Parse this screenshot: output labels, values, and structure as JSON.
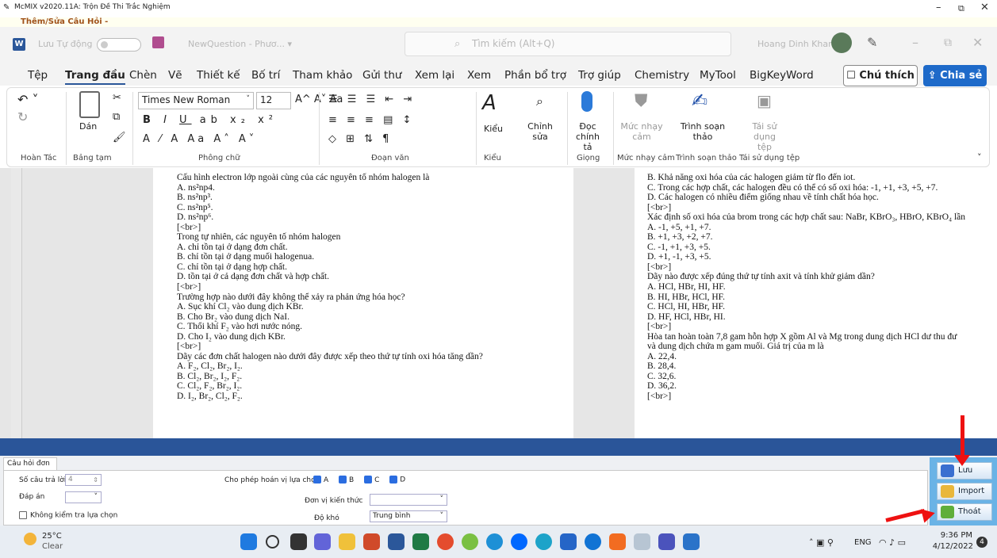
{
  "window": {
    "title": "McMIX v2020.11A: Trộn Đề Thi Trắc Nghiệm",
    "subtitle": "Thêm/Sửa Câu Hỏi -"
  },
  "word": {
    "autosave": "Lưu Tự động",
    "doc_name": "NewQuestion - Phươ... ▾",
    "search_placeholder": "Tìm kiếm (Alt+Q)",
    "user": "Hoang Dinh Khanh",
    "menu": [
      "Tệp",
      "Trang đầu",
      "Chèn",
      "Vẽ",
      "Thiết kế",
      "Bố trí",
      "Tham khảo",
      "Gửi thư",
      "Xem lại",
      "Xem",
      "Phần bổ trợ",
      "Trợ giúp",
      "Chemistry",
      "MyTool",
      "BigKeyWord"
    ],
    "note_button": "Chú thích",
    "share_button": "Chia sẻ"
  },
  "ribbon": {
    "font_name": "Times New Roman",
    "font_size": "12",
    "paste": "Dán",
    "styles": "Kiểu",
    "edit": "Chỉnh sửa",
    "dictate": "Đọc chính tả",
    "sensitivity": "Mức nhạy cảm",
    "editor": "Trình soạn thảo",
    "reuse": "Tái sử dụng tệp",
    "groups": [
      "Hoàn Tác",
      "Bảng tạm",
      "Phông chữ",
      "Đoạn văn",
      "Kiểu",
      "Giọng",
      "Mức nhạy cảm",
      "Trình soạn thảo",
      "Tái sử dụng tệp"
    ]
  },
  "doc": {
    "left": [
      "Cấu hình electron lớp ngoài cùng của các nguyên tố nhóm halogen là",
      "A. ns²np4.",
      "B. ns²np³.",
      "C. ns²np⁵.",
      "D. ns²np⁶.",
      "[<br>]",
      "Trong tự nhiên, các nguyên tố nhóm halogen",
      "A. chỉ tồn tại ở dạng đơn chất.",
      "B. chỉ tồn tại ở dạng muối halogenua.",
      "C. chỉ tồn tại ở dạng hợp chất.",
      "D. tồn tại ở cả dạng đơn chất và hợp chất.",
      "[<br>]",
      "Trường hợp nào dưới đây không thể xảy ra phản ứng hóa học?",
      "A. Sục khí Cl₂ vào dung dịch KBr.",
      "B. Cho Br₂ vào dung dịch NaI.",
      "C. Thổi khí F₂ vào hơi nước nóng.",
      "D. Cho I₂ vào dung dịch KBr.",
      "[<br>]",
      "Dãy các đơn chất halogen nào dưới đây được xếp theo thứ tự tính oxi hóa tăng dần?",
      "A. F₂, Cl₂, Br₂, I₂.",
      "B. Cl₂, Br₂, I₂, F₂.",
      "C. Cl₂, F₂, Br₂, I₂.",
      "D. I₂, Br₂, Cl₂, F₂."
    ],
    "right": [
      "B. Khả năng oxi hóa của các halogen giảm từ flo đến iot.",
      "C. Trong các hợp chất, các halogen đều có thể có số oxi hóa: -1, +1, +3, +5, +7.",
      "D. Các halogen có nhiều điểm giống nhau về tính chất hóa học.",
      "[<br>]",
      "Xác định số oxi hóa của brom trong các hợp chất sau: NaBr, KBrO₃, HBrO, KBrO₄ lần",
      "A. -1, +5, +1, +7.",
      "B. +1, +3, +2, +7.",
      "C. -1, +1, +3, +5.",
      "D. +1, -1, +3, +5.",
      "[<br>]",
      "Dãy nào được xếp đúng thứ tự tính axit và tính khử giảm dần?",
      "A. HCl, HBr, HI, HF.",
      "B. HI, HBr, HCl, HF.",
      "C. HCl, HI, HBr, HF.",
      "D. HF, HCl, HBr, HI.",
      "[<br>]",
      "Hòa tan hoàn toàn 7,8 gam hỗn hợp X gồm Al và Mg trong dung dịch HCl dư thu đư",
      "và dung dịch chứa m gam muối. Giá trị của m là",
      "A. 22,4.",
      "B. 28,4.",
      "C. 32,6.",
      "D. 36,2.",
      "[<br>]"
    ]
  },
  "form": {
    "tab": "Câu hỏi đơn",
    "num_answers_label": "Số câu trả lời",
    "num_answers_value": "4",
    "answer_label": "Đáp án",
    "no_check_label": "Không kiểm tra lựa chọn",
    "permute_label": "Cho phép hoán vị lựa chọn",
    "options": [
      "A",
      "B",
      "C",
      "D"
    ],
    "unit_label": "Đơn vị kiến thức",
    "difficulty_label": "Độ khó",
    "difficulty_value": "Trung bình"
  },
  "actions": {
    "save": "Lưu",
    "import": "Import",
    "exit": "Thoát"
  },
  "taskbar": {
    "weather_temp": "25°C",
    "weather_desc": "Clear",
    "lang": "ENG",
    "time": "9:36 PM",
    "date": "4/12/2022",
    "notif_count": "4"
  },
  "colors": {
    "word_blue": "#2b579a",
    "band_blue": "#2a5599",
    "action_panel": "#6ab3e6",
    "annotation_red": "#e11111"
  }
}
